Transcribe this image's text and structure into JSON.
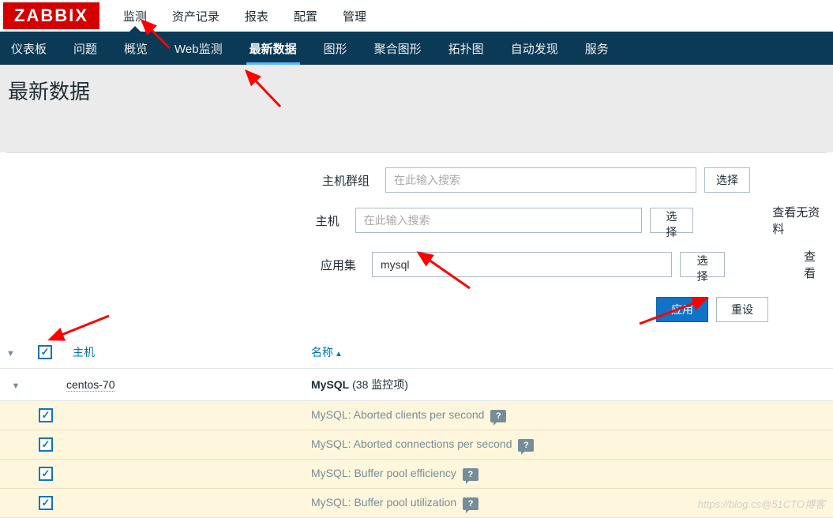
{
  "logo": "ZABBIX",
  "top_nav": {
    "items": [
      "监测",
      "资产记录",
      "报表",
      "配置",
      "管理"
    ],
    "active_index": 0
  },
  "sub_nav": {
    "items": [
      "仪表板",
      "问题",
      "概览",
      "Web监测",
      "最新数据",
      "图形",
      "聚合图形",
      "拓扑图",
      "自动发现",
      "服务"
    ],
    "active_index": 4
  },
  "page_title": "最新数据",
  "filter": {
    "host_group_label": "主机群组",
    "host_group_placeholder": "在此输入搜索",
    "host_label": "主机",
    "host_placeholder": "在此输入搜索",
    "app_label": "应用集",
    "app_value": "mysql",
    "select_btn": "选择",
    "apply_btn": "应用",
    "reset_btn": "重设",
    "side_label_1": "查看无资料",
    "side_label_2": "查看"
  },
  "table": {
    "headers": {
      "host": "主机",
      "name": "名称"
    },
    "group": {
      "host": "centos-70",
      "app": "MySQL",
      "count_text": "(38 监控项)"
    },
    "items": [
      {
        "name": "MySQL: Aborted clients per second"
      },
      {
        "name": "MySQL: Aborted connections per second"
      },
      {
        "name": "MySQL: Buffer pool efficiency"
      },
      {
        "name": "MySQL: Buffer pool utilization"
      }
    ]
  },
  "watermark": "https://blog.cs@51CTO博客",
  "help_badge": "?"
}
